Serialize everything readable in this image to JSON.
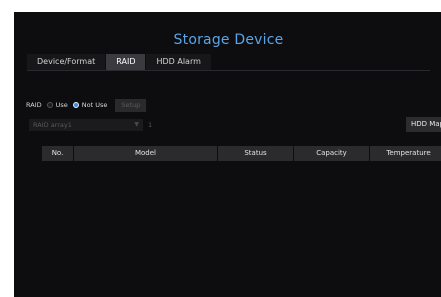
{
  "window": {
    "title": "Storage Device"
  },
  "tabs": [
    {
      "label": "Device/Format",
      "active": false
    },
    {
      "label": "RAID",
      "active": true
    },
    {
      "label": "HDD Alarm",
      "active": false
    }
  ],
  "raid": {
    "label": "RAID",
    "options": [
      {
        "label": "Use",
        "selected": false
      },
      {
        "label": "Not Use",
        "selected": true
      }
    ],
    "setup_label": "Setup",
    "setup_enabled": false
  },
  "array_select": {
    "value": "RAID array1",
    "extra": "1",
    "enabled": false
  },
  "hdd_map_label": "HDD Map",
  "table": {
    "columns": [
      "No.",
      "Model",
      "Status",
      "Capacity",
      "Temperature"
    ],
    "rows": []
  },
  "colors": {
    "panel_bg": "#0d0d0f",
    "title": "#5aa4e8",
    "tab_active_bg": "#3b3b3f",
    "radio_checked": "#3d8de0"
  }
}
